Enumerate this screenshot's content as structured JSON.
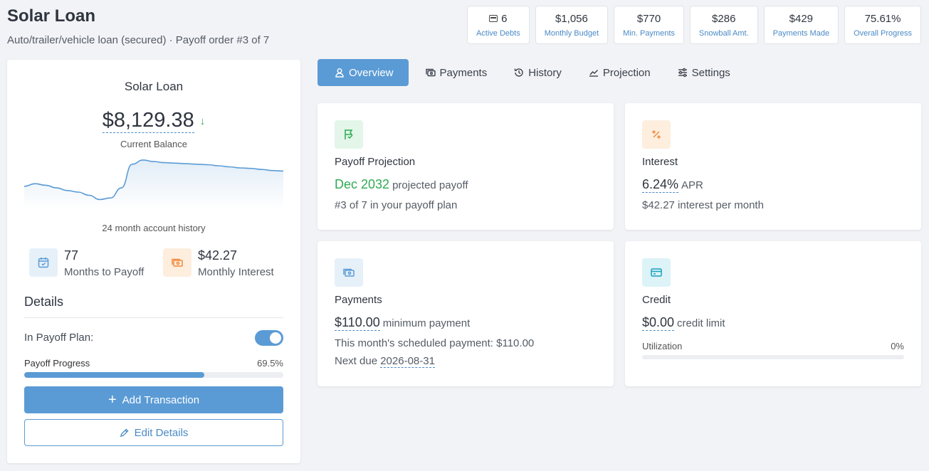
{
  "header": {
    "title": "Solar Loan",
    "subtitle": "Auto/trailer/vehicle loan (secured) · Payoff order #3 of 7"
  },
  "stats": [
    {
      "value": "6",
      "label": "Active Debts",
      "icon": "wallet-icon"
    },
    {
      "value": "$1,056",
      "label": "Monthly Budget"
    },
    {
      "value": "$770",
      "label": "Min. Payments"
    },
    {
      "value": "$286",
      "label": "Snowball Amt."
    },
    {
      "value": "$429",
      "label": "Payments Made"
    },
    {
      "value": "75.61%",
      "label": "Overall Progress"
    }
  ],
  "sidebar": {
    "title": "Solar Loan",
    "balance": "$8,129.38",
    "balance_label": "Current Balance",
    "trend_icon": "arrow-down-icon",
    "history_caption": "24 month account history",
    "history_values": [
      0.62,
      0.57,
      0.6,
      0.65,
      0.7,
      0.73,
      0.79,
      0.87,
      0.84,
      0.65,
      0.2,
      0.12,
      0.15,
      0.17,
      0.18,
      0.19,
      0.2,
      0.21,
      0.23,
      0.25,
      0.27,
      0.28,
      0.3,
      0.32,
      0.33
    ],
    "months_to_payoff": "77",
    "months_to_payoff_label": "Months to Payoff",
    "monthly_interest": "$42.27",
    "monthly_interest_label": "Monthly Interest",
    "details_heading": "Details",
    "in_plan_label": "In Payoff Plan:",
    "in_plan": true,
    "progress_label": "Payoff Progress",
    "progress_text": "69.5%",
    "progress_value": 0.695,
    "add_label": "Add Transaction",
    "edit_label": "Edit Details"
  },
  "tabs": [
    {
      "label": "Overview",
      "icon": "user-icon",
      "active": true
    },
    {
      "label": "Payments",
      "icon": "money-icon"
    },
    {
      "label": "History",
      "icon": "history-icon"
    },
    {
      "label": "Projection",
      "icon": "chart-line-icon"
    },
    {
      "label": "Settings",
      "icon": "sliders-icon"
    }
  ],
  "cards": {
    "projection": {
      "title": "Payoff Projection",
      "date": "Dec 2032",
      "date_suffix": "projected payoff",
      "order": "#3 of 7 in your payoff plan"
    },
    "interest": {
      "title": "Interest",
      "apr": "6.24%",
      "apr_suffix": "APR",
      "per_month": "$42.27 interest per month"
    },
    "payments": {
      "title": "Payments",
      "minimum": "$110.00",
      "minimum_suffix": "minimum payment",
      "scheduled": "This month's scheduled payment: $110.00",
      "next_due_prefix": "Next due",
      "next_due": "2026-08-31"
    },
    "credit": {
      "title": "Credit",
      "limit": "$0.00",
      "limit_suffix": "credit limit",
      "utilization_label": "Utilization",
      "utilization": "0%"
    }
  },
  "colors": {
    "accent": "#5b9bd5",
    "green": "#2eaa55",
    "orange": "#f08a3c",
    "teal": "#1aa0c0"
  }
}
